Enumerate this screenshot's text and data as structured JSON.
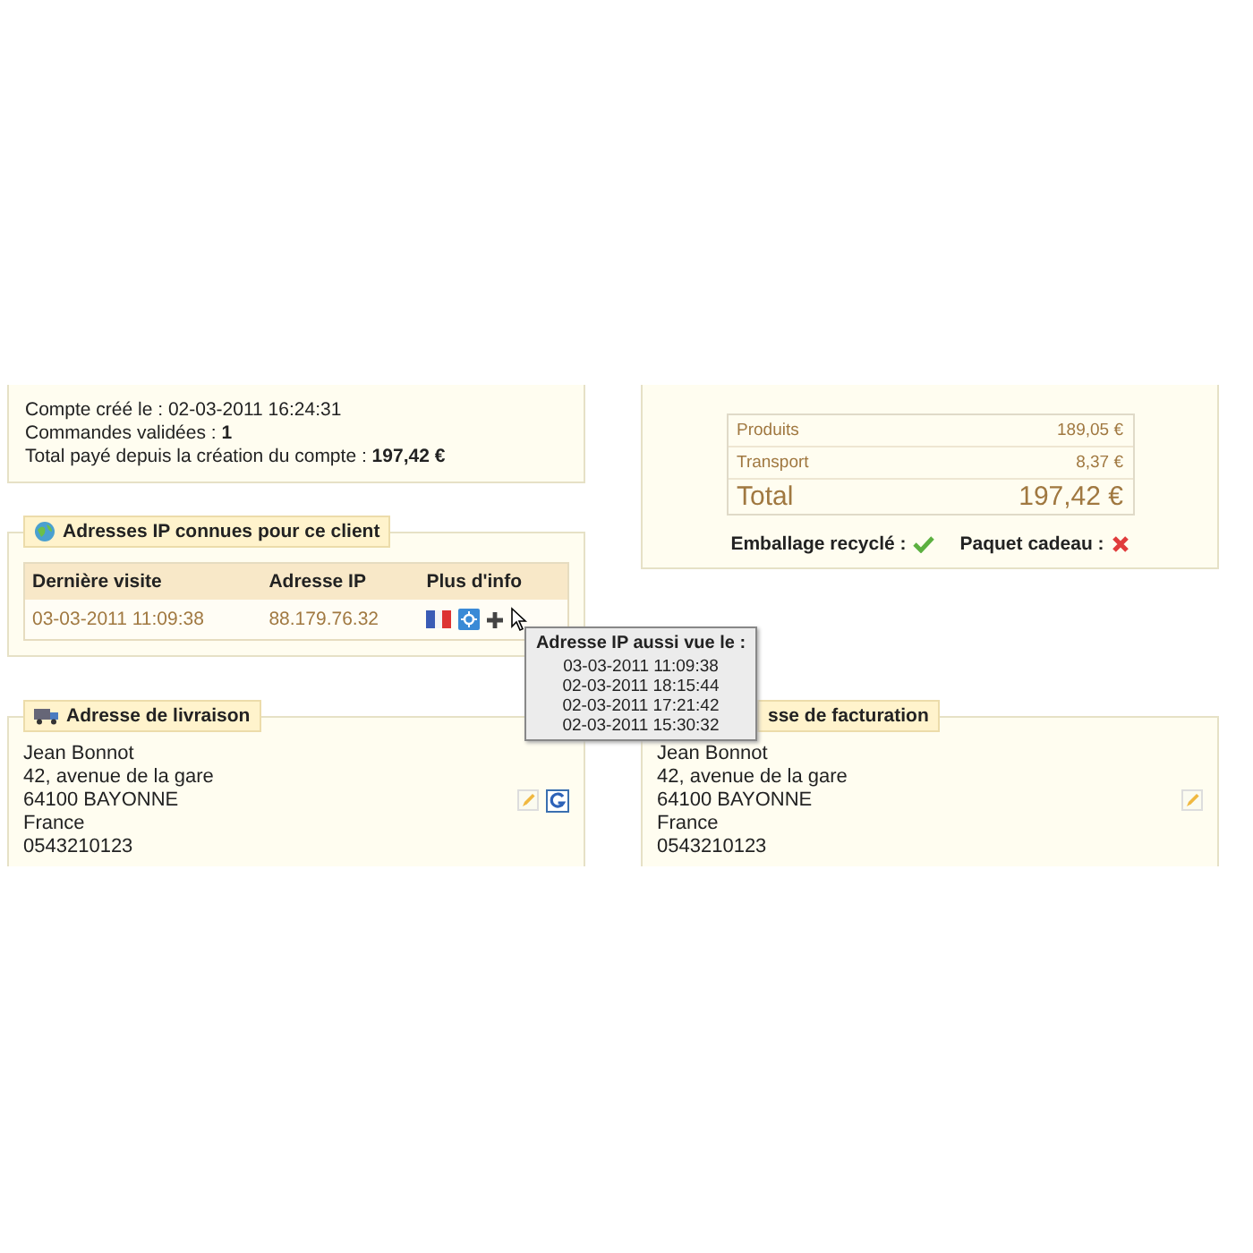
{
  "account": {
    "lines": [
      "Compte créé le : 02-03-2011 16:24:31",
      "Commandes validées : **1**",
      "Total payé depuis la création du compte : **197,42 €**"
    ]
  },
  "ip_panel": {
    "title": "Adresses IP connues pour ce client",
    "columns": [
      "Dernière visite",
      "Adresse IP",
      "Plus d'info"
    ],
    "rows": [
      {
        "last_visit": "03-03-2011 11:09:38",
        "ip": "88.179.76.32"
      }
    ]
  },
  "tooltip": {
    "title": "Adresse IP aussi vue le :",
    "dates": [
      "03-03-2011 11:09:38",
      "02-03-2011 18:15:44",
      "02-03-2011 17:21:42",
      "02-03-2011 15:30:32"
    ]
  },
  "totals": {
    "rows": [
      {
        "label": "Produits",
        "value": "189,05 €",
        "kind": "line"
      },
      {
        "label": "Transport",
        "value": "8,37 €",
        "kind": "line"
      },
      {
        "label": "Total",
        "value": "197,42 €",
        "kind": "total"
      }
    ],
    "options": [
      {
        "label": "Emballage recyclé :",
        "on": true
      },
      {
        "label": "Paquet cadeau :",
        "on": false
      }
    ]
  },
  "addresses": [
    {
      "kind": "shipping",
      "title": "Adresse de livraison",
      "lines": [
        "Jean Bonnot",
        "42, avenue de la gare",
        "64100 BAYONNE",
        "France",
        "0543210123"
      ]
    },
    {
      "kind": "billing",
      "title": "sse de facturation",
      "lines": [
        "Jean Bonnot",
        "42, avenue de la gare",
        "64100 BAYONNE",
        "France",
        "0543210123"
      ]
    }
  ]
}
